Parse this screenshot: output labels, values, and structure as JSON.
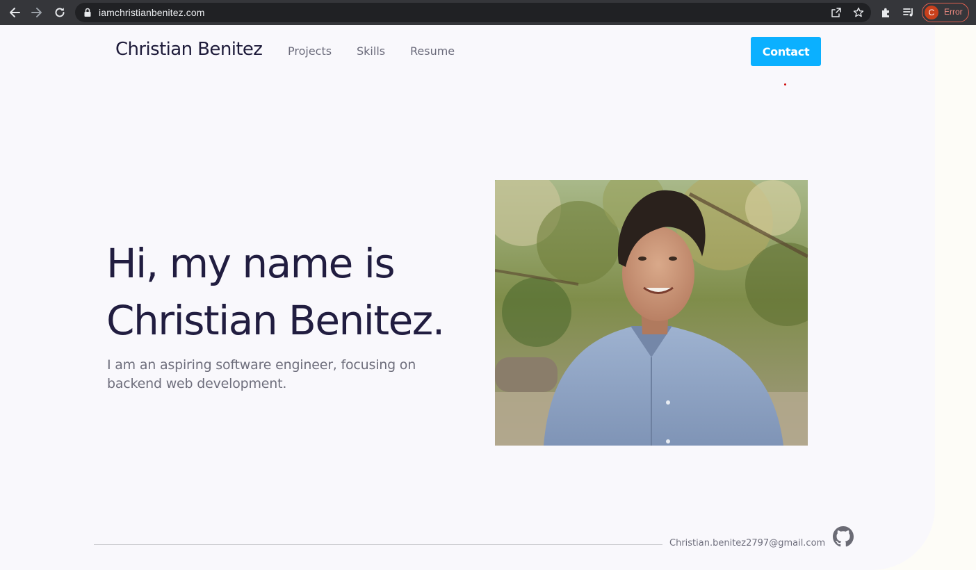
{
  "browser": {
    "url": "iamchristianbenitez.com",
    "profile_initial": "C",
    "profile_status": "Error"
  },
  "header": {
    "brand": "Christian Benitez",
    "nav": [
      {
        "label": "Projects"
      },
      {
        "label": "Skills"
      },
      {
        "label": "Resume"
      }
    ],
    "contact_label": "Contact"
  },
  "hero": {
    "title_line1": "Hi, my name is",
    "title_line2": "Christian Benitez.",
    "subtitle": "I am an aspiring software engineer, focusing on backend web development.",
    "photo_alt": "Portrait of Christian Benitez"
  },
  "footer": {
    "email": "Christian.benitez2797@gmail.com",
    "github_icon": "github-icon"
  },
  "colors": {
    "accent": "#0bb0ff",
    "heading": "#211d40",
    "muted": "#6e6e7c",
    "page_bg": "#f9f8fc",
    "chrome_bg": "#35363a"
  }
}
